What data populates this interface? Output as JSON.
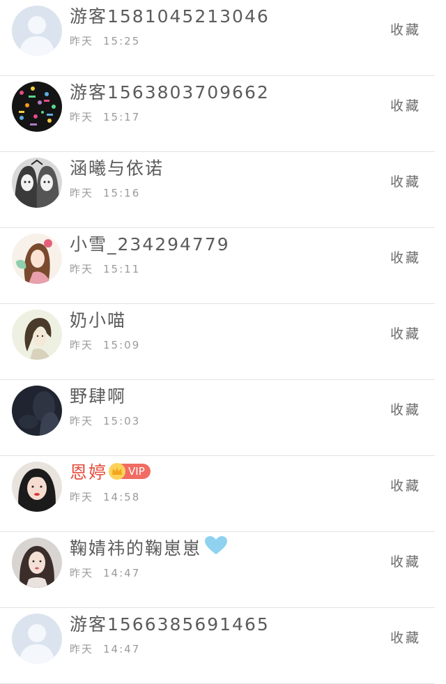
{
  "collect_label": "收藏",
  "rows": [
    {
      "name": "游客1581045213046",
      "day": "昨天",
      "time": "15:25",
      "avatar": "default-avatar"
    },
    {
      "name": "游客1563803709662",
      "day": "昨天",
      "time": "15:17",
      "avatar": "pattern-avatar"
    },
    {
      "name": "涵曦与依诺",
      "day": "昨天",
      "time": "15:16",
      "avatar": "anime-twins-avatar"
    },
    {
      "name": "小雪_234294779",
      "day": "昨天",
      "time": "15:11",
      "avatar": "anime-girl-avatar"
    },
    {
      "name": "奶小喵",
      "day": "昨天",
      "time": "15:09",
      "avatar": "sketch-girl-avatar"
    },
    {
      "name": "野肆啊",
      "day": "昨天",
      "time": "15:03",
      "avatar": "dark-photo-avatar"
    },
    {
      "name": "恩婷",
      "day": "昨天",
      "time": "14:58",
      "avatar": "photo-girl-avatar",
      "badge": "VIP",
      "badge_icon": "crown-icon"
    },
    {
      "name": "鞠婧祎的鞠崽崽",
      "day": "昨天",
      "time": "14:47",
      "avatar": "photo-woman-avatar",
      "suffix_icon": "heart-icon"
    },
    {
      "name": "游客1566385691465",
      "day": "昨天",
      "time": "14:47",
      "avatar": "default-avatar"
    }
  ],
  "colors": {
    "name": "#5b5b5b",
    "vip_name": "#e4503e",
    "time": "#9a9a9a",
    "collect": "#6b6b6b",
    "divider": "#e3e3e3",
    "heart": "#8fd2f0",
    "vip_badge": "#f16c62",
    "crown": "#fcd35a"
  }
}
